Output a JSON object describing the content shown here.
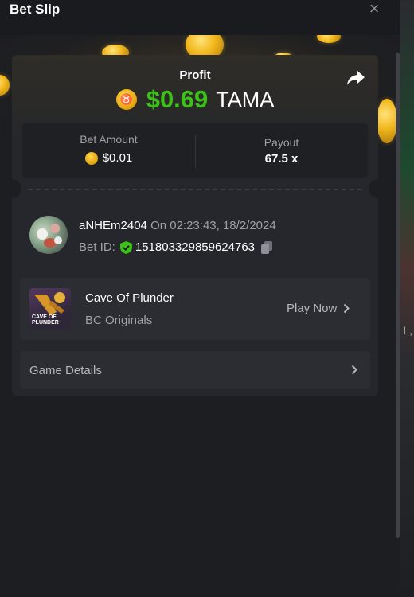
{
  "header": {
    "title": "Bet Slip",
    "close_label": "×"
  },
  "profit": {
    "label": "Profit",
    "amount": "$0.69",
    "currency": "TAMA",
    "coin_glyph": "♉"
  },
  "stats": {
    "bet_amount_label": "Bet Amount",
    "bet_amount_value": "$0.01",
    "payout_label": "Payout",
    "payout_value": "67.5 x"
  },
  "user": {
    "name": "aNHEm2404",
    "on_time": "On 02:23:43, 18/2/2024",
    "bet_id_label": "Bet ID:",
    "bet_id": "151803329859624763"
  },
  "game": {
    "name": "Cave Of Plunder",
    "provider": "BC Originals",
    "thumb_text": "CAVE OF PLUNDER",
    "play_label": "Play Now"
  },
  "details": {
    "label": "Game Details"
  },
  "background_fragment": "L,",
  "colors": {
    "background": "#1c1e22",
    "card": "#25272c",
    "profit_green": "#3bc117",
    "muted_text": "#9ea1a7",
    "shield_green": "#3bc117",
    "coin_gold": "#f2b81c"
  },
  "icons": {
    "close": "close-icon",
    "share": "share-icon",
    "coin": "tama-coin-icon",
    "shield": "verified-shield-icon",
    "copy": "copy-icon",
    "chevron": "chevron-right-icon"
  }
}
